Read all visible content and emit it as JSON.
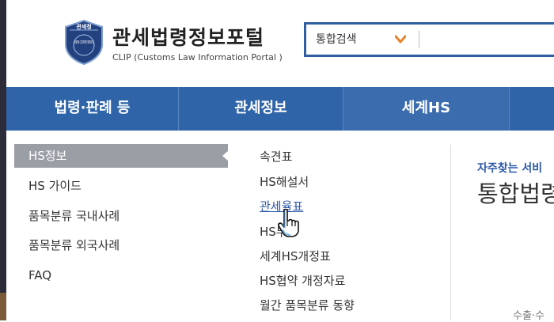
{
  "header": {
    "shield_text": "관세청",
    "shield_subtext": "KOREA CUSTOMS SERVICE",
    "title": "관세법령정보포털",
    "subtitle": "CLIP (Customs Law Information Portal )",
    "search": {
      "selected": "통합검색",
      "placeholder": "",
      "value": ""
    }
  },
  "nav": {
    "items": [
      {
        "label": "법령·판례 등"
      },
      {
        "label": "관세정보"
      },
      {
        "label": "세계HS"
      },
      {
        "label": ""
      }
    ]
  },
  "submenu_left": {
    "items": [
      {
        "label": "HS정보",
        "active": true
      },
      {
        "label": "HS 가이드"
      },
      {
        "label": "품목분류 국내사례"
      },
      {
        "label": "품목분류 외국사례"
      },
      {
        "label": "FAQ"
      }
    ]
  },
  "submenu_mid": {
    "items": [
      {
        "label": "속견표"
      },
      {
        "label": "HS해설서"
      },
      {
        "label": "관세율표",
        "hovered": true
      },
      {
        "label": "HS부"
      },
      {
        "label": "세계HS개정표"
      },
      {
        "label": "HS협약 개정자료"
      },
      {
        "label": "월간 품목분류 동향"
      }
    ]
  },
  "right_panel": {
    "label": "자주찾는 서비",
    "title": "통합법령",
    "bottom_text": "수출·수"
  },
  "colors": {
    "nav_bg": "#2f64a8",
    "active_item_bg": "#9a9ea5",
    "link": "#2b57a8",
    "search_border": "#2f5fa0",
    "chevron": "#e8822a"
  },
  "icons": {
    "logo": "customs-shield-icon",
    "dropdown": "chevron-down-icon",
    "cursor": "hand-pointer-icon"
  }
}
